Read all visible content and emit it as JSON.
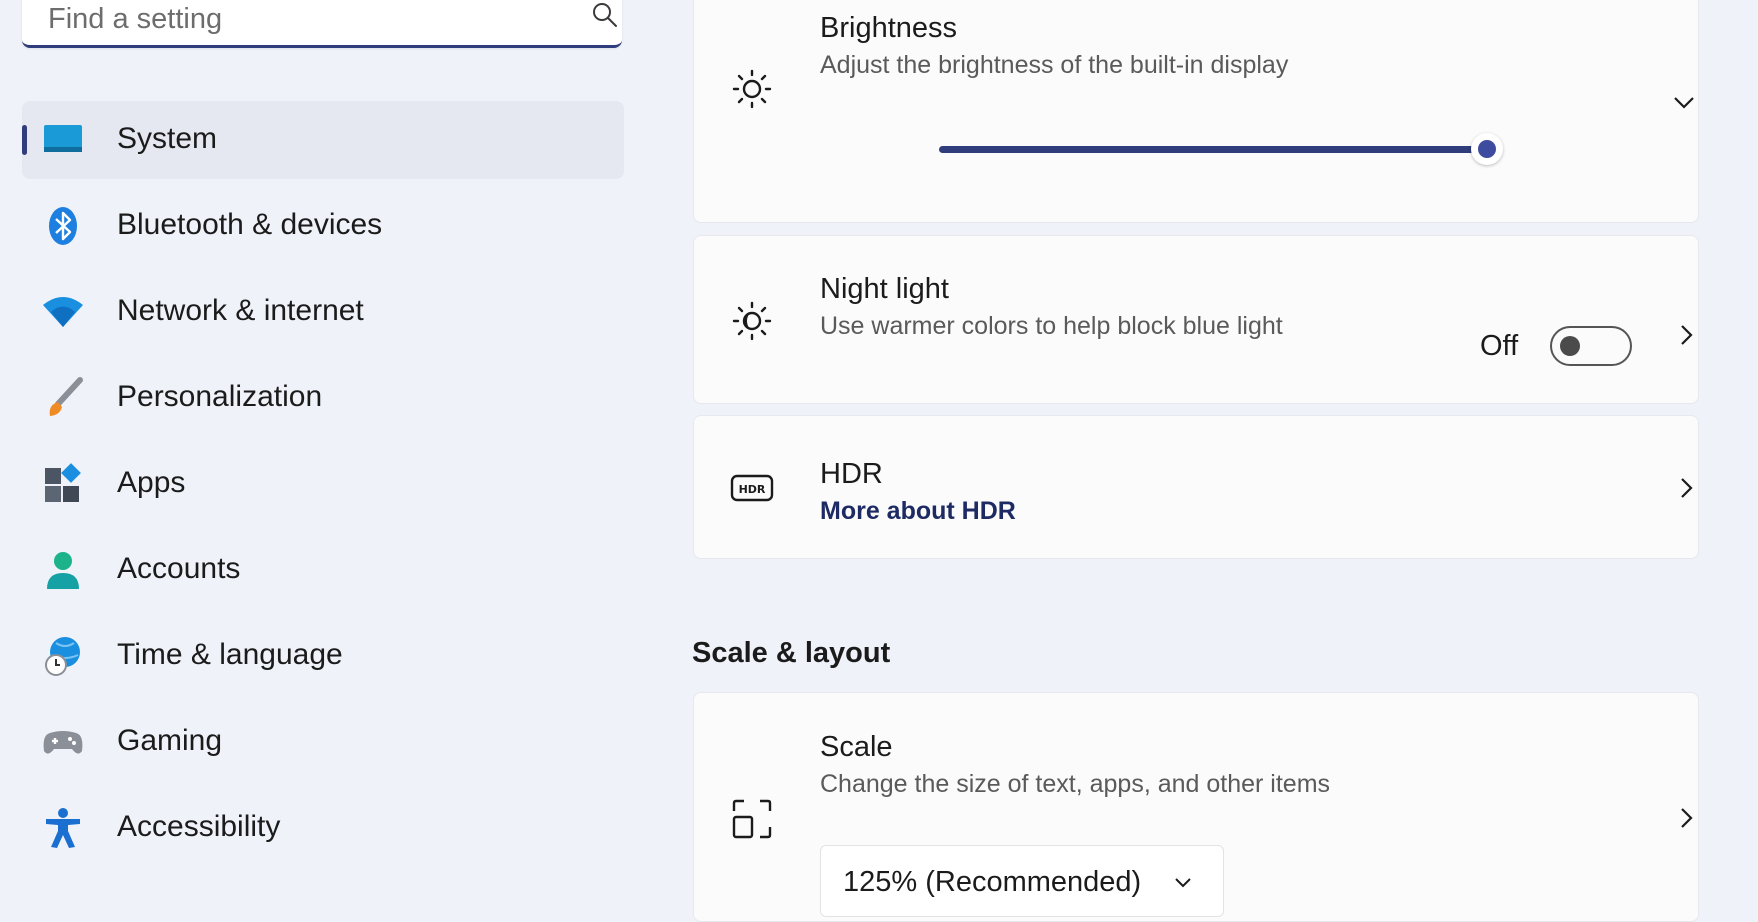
{
  "search": {
    "placeholder": "Find a setting"
  },
  "sidebar": {
    "items": [
      {
        "label": "System",
        "selected": true
      },
      {
        "label": "Bluetooth & devices"
      },
      {
        "label": "Network & internet"
      },
      {
        "label": "Personalization"
      },
      {
        "label": "Apps"
      },
      {
        "label": "Accounts"
      },
      {
        "label": "Time & language"
      },
      {
        "label": "Gaming"
      },
      {
        "label": "Accessibility"
      }
    ]
  },
  "brightness": {
    "title": "Brightness",
    "description": "Adjust the brightness of the built-in display",
    "level_percent": 100
  },
  "night_light": {
    "title": "Night light",
    "description": "Use warmer colors to help block blue light",
    "toggle_state": "Off"
  },
  "hdr": {
    "title": "HDR",
    "link": "More about HDR"
  },
  "scale_layout": {
    "section_title": "Scale & layout",
    "scale": {
      "title": "Scale",
      "description": "Change the size of text, apps, and other items",
      "selected": "125% (Recommended)"
    }
  },
  "colors": {
    "accent": "#2f3d7c",
    "background": "#eff2f9",
    "card": "#fbfbfc"
  }
}
